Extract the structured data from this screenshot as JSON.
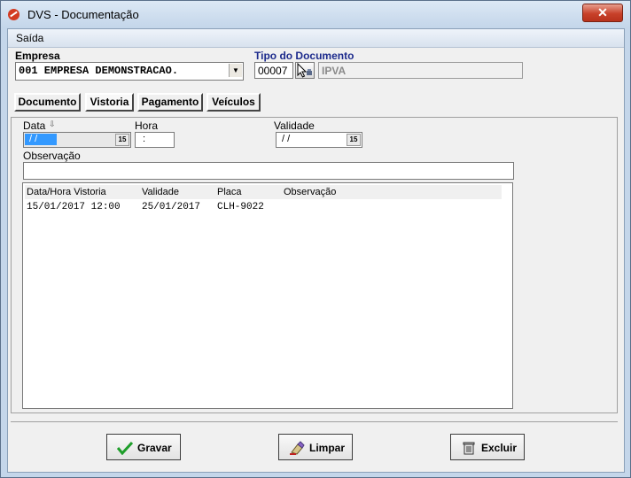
{
  "window": {
    "title": "DVS - Documentação",
    "close_label": "✕"
  },
  "menu": {
    "items": [
      "Saída"
    ]
  },
  "empresa": {
    "label": "Empresa",
    "value": "001 EMPRESA DEMONSTRACAO."
  },
  "tipo_documento": {
    "label": "Tipo do Documento",
    "code": "00007",
    "description": "IPVA"
  },
  "tabs": [
    {
      "label": "Documento",
      "active": false
    },
    {
      "label": "Vistoria",
      "active": true
    },
    {
      "label": "Pagamento",
      "active": false
    },
    {
      "label": "Veículos",
      "active": false
    }
  ],
  "vistoria": {
    "data_label": "Data",
    "data_value": " / /",
    "hora_label": "Hora",
    "hora_value": ":",
    "validade_label": "Validade",
    "validade_value": " / /",
    "observacao_label": "Observação",
    "observacao_value": "",
    "calendar_icon_text": "15"
  },
  "grid": {
    "columns": [
      "Data/Hora Vistoria",
      "Validade",
      "Placa",
      "Observação"
    ],
    "rows": [
      {
        "data_hora": "15/01/2017 12:00",
        "validade": "25/01/2017",
        "placa": "CLH-9022",
        "observacao": ""
      }
    ]
  },
  "buttons": {
    "gravar": "Gravar",
    "limpar": "Limpar",
    "excluir": "Excluir"
  },
  "colors": {
    "title_bg": "#c4d6ea",
    "close_red": "#c8412a",
    "navy_label": "#1c2a8c",
    "selection_blue": "#3399ff"
  },
  "icons": [
    "app-logo-icon",
    "close-icon",
    "dropdown-arrow-icon",
    "lookup-cursor-icon",
    "sort-icon",
    "calendar-icon",
    "check-icon",
    "eraser-icon",
    "trash-icon"
  ]
}
